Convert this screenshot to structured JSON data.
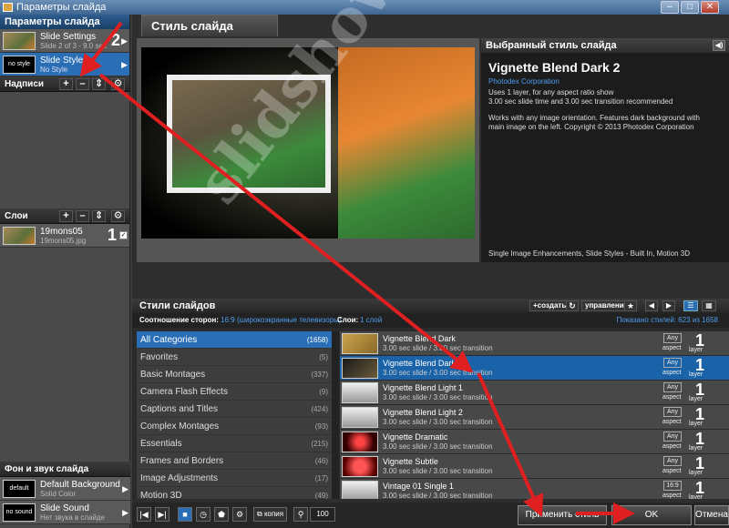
{
  "window": {
    "title": "Параметры слайда",
    "minimize": "–",
    "maximize": "□",
    "close": "✕"
  },
  "left": {
    "params_header": "Параметры слайда",
    "slide_settings": {
      "title": "Slide Settings",
      "sub": "Slide 2 of 3 - 9.0 sec",
      "num": "2"
    },
    "slide_style": {
      "thumb": "no style",
      "title": "Slide Style",
      "sub": "No Style"
    },
    "captions_label": "Надписи",
    "layers_label": "Слои",
    "layer": {
      "title": "19mons05",
      "sub": "19mons05.jpg",
      "num": "1"
    },
    "bg_header": "Фон и звук слайда",
    "bg_item": {
      "thumb": "default",
      "title": "Default Background",
      "sub": "Solid Color"
    },
    "sound_item": {
      "thumb": "no sound",
      "title": "Slide Sound",
      "sub": "Нет звука в слайде"
    }
  },
  "main": {
    "tab": "Стиль слайда",
    "info": {
      "header": "Выбранный стиль слайда",
      "title": "Vignette Blend Dark 2",
      "company": "Photodex Corporation",
      "d1": "Uses 1 layer, for any aspect ratio show",
      "d2": "3.00 sec slide time and 3.00 sec transition recommended",
      "d3": "Works with any image orientation. Features dark background with main image on the left. Copyright © 2013 Photodex Corporation",
      "tags": "Single Image Enhancements, Slide Styles - Built In, Motion 3D"
    },
    "styles": {
      "header": "Стили слайдов",
      "create": "создать",
      "manage": "управление",
      "ratio_label": "Соотношение сторон:",
      "ratio_value": "16:9 (широкоэкранные телевизоры)",
      "layers_label": "Слои:",
      "layers_value": "1 слой",
      "shown": "Показано стилей: 623 из 1658"
    },
    "categories": [
      {
        "name": "All Categories",
        "count": "(1658)"
      },
      {
        "name": "Favorites",
        "count": "(5)"
      },
      {
        "name": "Basic Montages",
        "count": "(337)"
      },
      {
        "name": "Camera Flash Effects",
        "count": "(9)"
      },
      {
        "name": "Captions and Titles",
        "count": "(424)"
      },
      {
        "name": "Complex Montages",
        "count": "(93)"
      },
      {
        "name": "Essentials",
        "count": "(215)"
      },
      {
        "name": "Frames and Borders",
        "count": "(46)"
      },
      {
        "name": "Image Adjustments",
        "count": "(17)"
      },
      {
        "name": "Motion 3D",
        "count": "(49)"
      }
    ],
    "list": [
      {
        "name": "Vignette Blend Dark",
        "sub": "3.00 sec slide / 3.00 sec transition",
        "aspect": "Any",
        "aspect_label": "aspect",
        "layers": "1",
        "layer_label": "layer"
      },
      {
        "name": "Vignette Blend Dark 2",
        "sub": "3.00 sec slide / 3.00 sec transition",
        "aspect": "Any",
        "aspect_label": "aspect",
        "layers": "1",
        "layer_label": "layer"
      },
      {
        "name": "Vignette Blend Light 1",
        "sub": "3.00 sec slide / 3.00 sec transition",
        "aspect": "Any",
        "aspect_label": "aspect",
        "layers": "1",
        "layer_label": "layer"
      },
      {
        "name": "Vignette Blend Light 2",
        "sub": "3.00 sec slide / 3.00 sec transition",
        "aspect": "Any",
        "aspect_label": "aspect",
        "layers": "1",
        "layer_label": "layer"
      },
      {
        "name": "Vignette Dramatic",
        "sub": "3.00 sec slide / 3.00 sec transition",
        "aspect": "Any",
        "aspect_label": "aspect",
        "layers": "1",
        "layer_label": "layer"
      },
      {
        "name": "Vignette Subtle",
        "sub": "3.00 sec slide / 3.00 sec transition",
        "aspect": "Any",
        "aspect_label": "aspect",
        "layers": "1",
        "layer_label": "layer"
      },
      {
        "name": "Vintage 01 Single 1",
        "sub": "3.00 sec slide / 3.00 sec transition",
        "aspect": "16:9",
        "aspect_label": "aspect",
        "layers": "1",
        "layer_label": "layer"
      }
    ],
    "bottom": {
      "copy": "копия",
      "zoom": "100",
      "apply": "Применить стиль",
      "ok": "OK",
      "cancel": "Отмена"
    }
  },
  "watermark": "slidshow.ru",
  "colors": {
    "accent": "#2a6fb5",
    "arrow": "#e02020"
  }
}
